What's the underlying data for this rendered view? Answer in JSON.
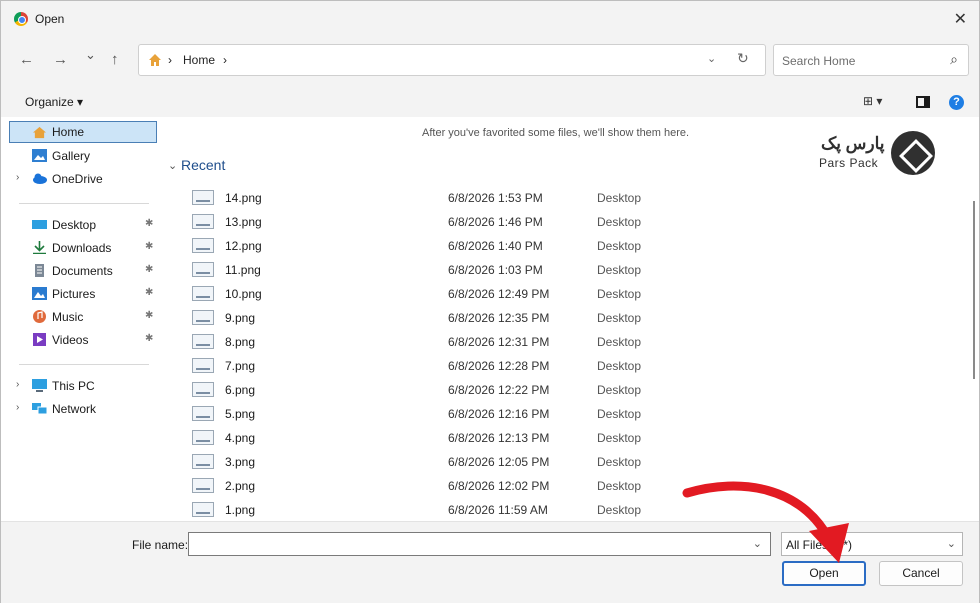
{
  "window": {
    "title": "Open",
    "close": "✕"
  },
  "nav": {
    "back": "←",
    "forward": "→",
    "recent": "⌄",
    "up": "↑"
  },
  "address": {
    "crumbs": [
      "Home"
    ],
    "sep": "›",
    "dropdown": "⌄",
    "refresh": "↻"
  },
  "search": {
    "placeholder": "Search Home",
    "icon": "⌕"
  },
  "toolbar": {
    "organize": "Organize ▾",
    "view": "⊞ ▾",
    "help": "?"
  },
  "sidebar": {
    "items": [
      {
        "label": "Home",
        "icon": "home-icon",
        "color": "#e8a23a"
      },
      {
        "label": "Gallery",
        "icon": "gallery-icon",
        "color": "#2f7fd1"
      },
      {
        "label": "OneDrive",
        "icon": "cloud-icon",
        "color": "#1a73d9",
        "expand": "›"
      },
      {
        "label": "Desktop",
        "icon": "desktop-icon",
        "color": "#2d9fe0",
        "pin": "📌"
      },
      {
        "label": "Downloads",
        "icon": "download-icon",
        "color": "#1f7a3d",
        "pin": "📌"
      },
      {
        "label": "Documents",
        "icon": "document-icon",
        "color": "#7c8896",
        "pin": "📌"
      },
      {
        "label": "Pictures",
        "icon": "pictures-icon",
        "color": "#2a7bd0",
        "pin": "📌"
      },
      {
        "label": "Music",
        "icon": "music-icon",
        "color": "#e06a3c",
        "pin": "📌"
      },
      {
        "label": "Videos",
        "icon": "videos-icon",
        "color": "#7a3cc2",
        "pin": "📌"
      },
      {
        "label": "This PC",
        "icon": "pc-icon",
        "color": "#2d9fe0",
        "expand": "›"
      },
      {
        "label": "Network",
        "icon": "network-icon",
        "color": "#2d9fe0",
        "expand": "›"
      }
    ]
  },
  "main": {
    "hint": "After you've favorited some files, we'll show them here.",
    "group": "Recent",
    "group_chev": "⌄",
    "logo": {
      "fa": "پارس پک",
      "en": "Pars Pack"
    },
    "files": [
      {
        "name": "14.png",
        "date": "6/8/2026 1:53 PM",
        "location": "Desktop"
      },
      {
        "name": "13.png",
        "date": "6/8/2026 1:46 PM",
        "location": "Desktop"
      },
      {
        "name": "12.png",
        "date": "6/8/2026 1:40 PM",
        "location": "Desktop"
      },
      {
        "name": "11.png",
        "date": "6/8/2026 1:03 PM",
        "location": "Desktop"
      },
      {
        "name": "10.png",
        "date": "6/8/2026 12:49 PM",
        "location": "Desktop"
      },
      {
        "name": "9.png",
        "date": "6/8/2026 12:35 PM",
        "location": "Desktop"
      },
      {
        "name": "8.png",
        "date": "6/8/2026 12:31 PM",
        "location": "Desktop"
      },
      {
        "name": "7.png",
        "date": "6/8/2026 12:28 PM",
        "location": "Desktop"
      },
      {
        "name": "6.png",
        "date": "6/8/2026 12:22 PM",
        "location": "Desktop"
      },
      {
        "name": "5.png",
        "date": "6/8/2026 12:16 PM",
        "location": "Desktop"
      },
      {
        "name": "4.png",
        "date": "6/8/2026 12:13 PM",
        "location": "Desktop"
      },
      {
        "name": "3.png",
        "date": "6/8/2026 12:05 PM",
        "location": "Desktop"
      },
      {
        "name": "2.png",
        "date": "6/8/2026 12:02 PM",
        "location": "Desktop"
      },
      {
        "name": "1.png",
        "date": "6/8/2026 11:59 AM",
        "location": "Desktop"
      }
    ]
  },
  "bottom": {
    "filename_label": "File name:",
    "filename_value": "",
    "filetype": "All Files (*.*)",
    "open": "Open",
    "cancel": "Cancel",
    "chev": "⌄"
  },
  "colors": {
    "accent": "#2b6cc4",
    "arrow": "#e21a22",
    "selected": "#cce4f7"
  }
}
